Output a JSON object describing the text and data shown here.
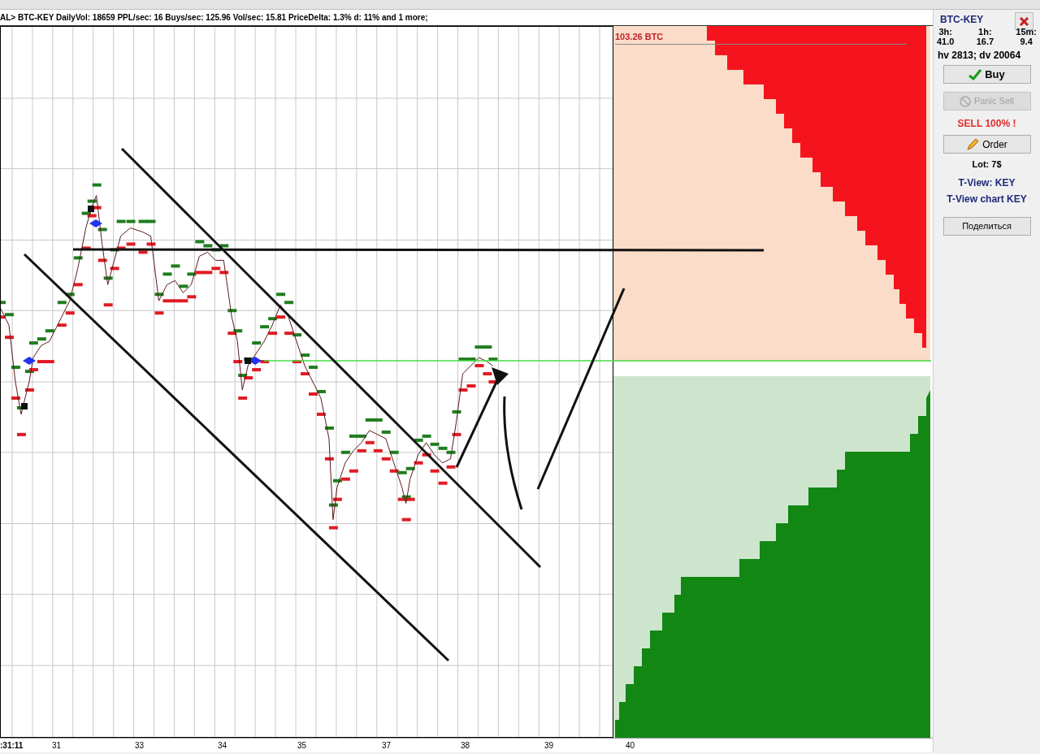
{
  "header": {
    "text": "AL> BTC-KEY  DailyVol: 18659 PPL/sec: 16  Buys/sec: 125.96 Vol/sec: 15.81 PriceDelta: 1.3%  d: 11% and 1 more;"
  },
  "chart": {
    "x_labels": [
      ":31:11",
      "31",
      "33",
      "34",
      "35",
      "37",
      "38",
      "39",
      "40"
    ]
  },
  "order_book": {
    "ask_volume": "103.26 BTC"
  },
  "panel": {
    "symbol": "BTC-KEY",
    "stats": [
      {
        "label": "3h:",
        "value": "41.0"
      },
      {
        "label": "1h:",
        "value": "16.7"
      },
      {
        "label": "15m:",
        "value": "9.4"
      }
    ],
    "volumes": "hv 2813; dv 20064",
    "buy": {
      "label": "Buy"
    },
    "panic_sell": {
      "label": "Panic Sell",
      "disabled": true
    },
    "sell_notice": "SELL 100% !",
    "order": {
      "label": "Order"
    },
    "lot": "Lot: 7$",
    "tview": "T-View: KEY",
    "tview_chart": "T-View chart KEY",
    "share": {
      "label": "Поделиться"
    }
  }
}
